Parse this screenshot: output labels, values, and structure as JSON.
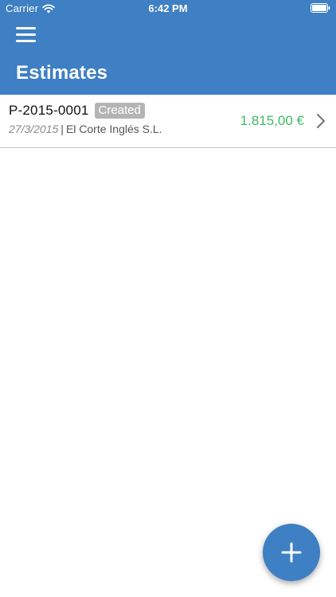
{
  "status_bar": {
    "carrier": "Carrier",
    "time": "6:42 PM",
    "wifi_icon": "wifi-icon",
    "battery_icon": "battery-icon"
  },
  "nav": {
    "menu_icon": "hamburger-menu-icon",
    "title": "Estimates"
  },
  "estimates": [
    {
      "number": "P-2015-0001",
      "status": "Created",
      "date": "27/3/2015",
      "separator": "|",
      "client": "El Corte Inglés S.L.",
      "amount": "1.815,00 €"
    }
  ],
  "fab": {
    "icon": "plus-icon"
  },
  "colors": {
    "primary": "#3f7fc3",
    "amount_green": "#3dbb63",
    "badge_gray": "#b4b4b4"
  }
}
